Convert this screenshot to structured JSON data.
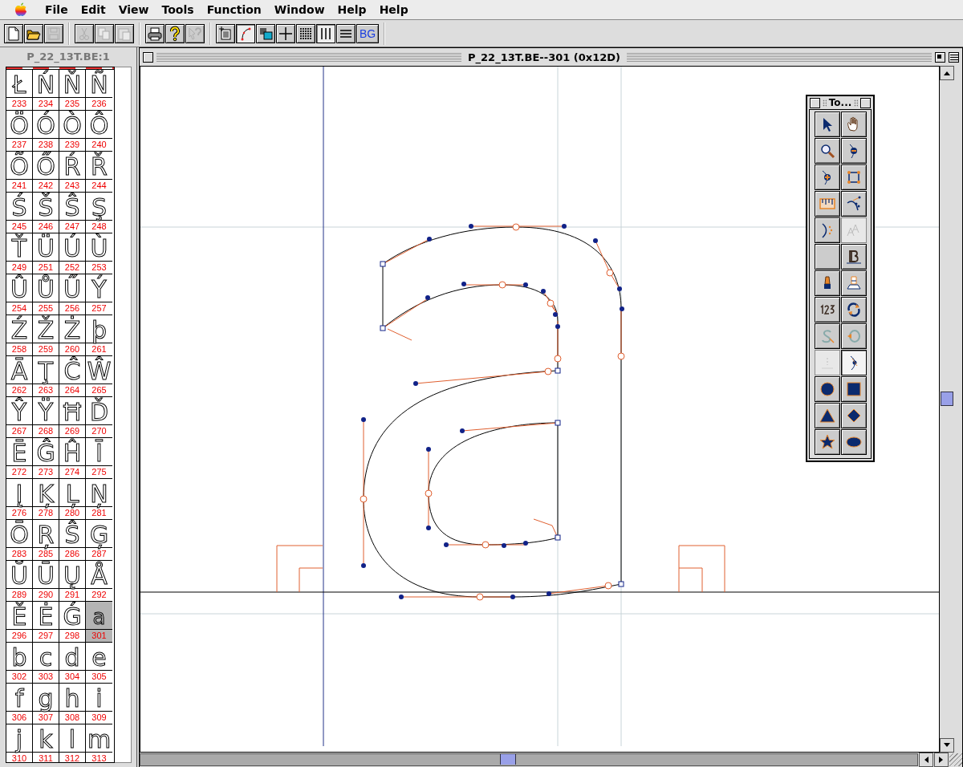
{
  "menu_bar": {
    "items": [
      "File",
      "Edit",
      "View",
      "Tools",
      "Function",
      "Window",
      "Help",
      "Help"
    ]
  },
  "toolbar": {
    "groups": [
      [
        {
          "kind": "new",
          "disabled": false
        },
        {
          "kind": "open",
          "disabled": false
        },
        {
          "kind": "save",
          "disabled": true
        }
      ],
      [
        {
          "kind": "cut",
          "disabled": true
        },
        {
          "kind": "copy",
          "disabled": true
        },
        {
          "kind": "paste",
          "disabled": true
        }
      ],
      [
        {
          "kind": "print",
          "disabled": false
        },
        {
          "kind": "help",
          "disabled": false
        },
        {
          "kind": "context-help",
          "disabled": true
        }
      ],
      [
        {
          "kind": "info",
          "disabled": false,
          "selected": false
        },
        {
          "kind": "points",
          "disabled": false,
          "selected": true
        },
        {
          "kind": "layers",
          "disabled": false,
          "selected": false
        },
        {
          "kind": "cross",
          "disabled": false,
          "selected": false
        },
        {
          "kind": "grid",
          "disabled": false,
          "selected": false
        },
        {
          "kind": "vlines",
          "disabled": false,
          "selected": true
        },
        {
          "kind": "hlines",
          "disabled": false,
          "selected": false
        },
        {
          "kind": "text",
          "label": "BG",
          "disabled": false,
          "selected": false
        }
      ]
    ]
  },
  "font_window": {
    "title": "P_22_13T.BE:1",
    "glyphs": [
      {
        "char": "Ł",
        "code": "233",
        "selected": false
      },
      {
        "char": "Ń",
        "code": "234",
        "selected": false
      },
      {
        "char": "Ň",
        "code": "235",
        "selected": false
      },
      {
        "char": "Ñ",
        "code": "236",
        "selected": false
      },
      {
        "char": "Ö",
        "code": "237",
        "selected": false
      },
      {
        "char": "Ó",
        "code": "238",
        "selected": false
      },
      {
        "char": "Ò",
        "code": "239",
        "selected": false
      },
      {
        "char": "Ô",
        "code": "240",
        "selected": false
      },
      {
        "char": "Õ",
        "code": "241",
        "selected": false
      },
      {
        "char": "Ő",
        "code": "242",
        "selected": false
      },
      {
        "char": "Ŕ",
        "code": "243",
        "selected": false
      },
      {
        "char": "Ř",
        "code": "244",
        "selected": false
      },
      {
        "char": "Ś",
        "code": "245",
        "selected": false
      },
      {
        "char": "Š",
        "code": "246",
        "selected": false
      },
      {
        "char": "Ŝ",
        "code": "247",
        "selected": false
      },
      {
        "char": "Ş",
        "code": "248",
        "selected": false
      },
      {
        "char": "Ť",
        "code": "249",
        "selected": false
      },
      {
        "char": "Ü",
        "code": "251",
        "selected": false
      },
      {
        "char": "Ú",
        "code": "252",
        "selected": false
      },
      {
        "char": "Ù",
        "code": "253",
        "selected": false
      },
      {
        "char": "Û",
        "code": "254",
        "selected": false
      },
      {
        "char": "Ů",
        "code": "255",
        "selected": false
      },
      {
        "char": "Ű",
        "code": "256",
        "selected": false
      },
      {
        "char": "Ý",
        "code": "257",
        "selected": false
      },
      {
        "char": "Ź",
        "code": "258",
        "selected": false
      },
      {
        "char": "Ž",
        "code": "259",
        "selected": false
      },
      {
        "char": "Ż",
        "code": "260",
        "selected": false
      },
      {
        "char": "þ",
        "code": "261",
        "selected": false
      },
      {
        "char": "Ā",
        "code": "262",
        "selected": false
      },
      {
        "char": "Ţ",
        "code": "263",
        "selected": false
      },
      {
        "char": "Ĉ",
        "code": "264",
        "selected": false
      },
      {
        "char": "Ŵ",
        "code": "265",
        "selected": false
      },
      {
        "char": "Ŷ",
        "code": "267",
        "selected": false
      },
      {
        "char": "Ÿ",
        "code": "268",
        "selected": false
      },
      {
        "char": "Ħ",
        "code": "269",
        "selected": false
      },
      {
        "char": "Ď",
        "code": "270",
        "selected": false
      },
      {
        "char": "Ē",
        "code": "272",
        "selected": false
      },
      {
        "char": "Ĝ",
        "code": "273",
        "selected": false
      },
      {
        "char": "Ĥ",
        "code": "274",
        "selected": false
      },
      {
        "char": "Ī",
        "code": "275",
        "selected": false
      },
      {
        "char": "Į",
        "code": "276",
        "selected": false
      },
      {
        "char": "Ķ",
        "code": "278",
        "selected": false
      },
      {
        "char": "Ļ",
        "code": "280",
        "selected": false
      },
      {
        "char": "Ņ",
        "code": "281",
        "selected": false
      },
      {
        "char": "Ō",
        "code": "283",
        "selected": false
      },
      {
        "char": "Ŗ",
        "code": "285",
        "selected": false
      },
      {
        "char": "Ŝ",
        "code": "286",
        "selected": false
      },
      {
        "char": "Ģ",
        "code": "287",
        "selected": false
      },
      {
        "char": "Ŭ",
        "code": "289",
        "selected": false
      },
      {
        "char": "Ū",
        "code": "290",
        "selected": false
      },
      {
        "char": "Ų",
        "code": "291",
        "selected": false
      },
      {
        "char": "Å",
        "code": "292",
        "selected": false
      },
      {
        "char": "Ě",
        "code": "296",
        "selected": false
      },
      {
        "char": "Ė",
        "code": "297",
        "selected": false
      },
      {
        "char": "Ǵ",
        "code": "298",
        "selected": false
      },
      {
        "char": "a",
        "code": "301",
        "selected": true
      },
      {
        "char": "b",
        "code": "302",
        "selected": false
      },
      {
        "char": "c",
        "code": "303",
        "selected": false
      },
      {
        "char": "d",
        "code": "304",
        "selected": false
      },
      {
        "char": "e",
        "code": "305",
        "selected": false
      },
      {
        "char": "f",
        "code": "306",
        "selected": false
      },
      {
        "char": "g",
        "code": "307",
        "selected": false
      },
      {
        "char": "h",
        "code": "308",
        "selected": false
      },
      {
        "char": "i",
        "code": "309",
        "selected": false
      },
      {
        "char": "j",
        "code": "310",
        "selected": false
      },
      {
        "char": "k",
        "code": "311",
        "selected": false
      },
      {
        "char": "l",
        "code": "312",
        "selected": false
      },
      {
        "char": "m",
        "code": "313",
        "selected": false
      }
    ]
  },
  "outline_window": {
    "title": "P_22_13T.BE--301 (0x12D)"
  },
  "tool_palette": {
    "title": "To...",
    "tools": [
      {
        "kind": "pointer",
        "selected": false,
        "disabled": false
      },
      {
        "kind": "hand",
        "selected": false,
        "disabled": false
      },
      {
        "kind": "zoom",
        "selected": false,
        "disabled": false
      },
      {
        "kind": "remove-point",
        "selected": false,
        "disabled": false
      },
      {
        "kind": "add-point",
        "selected": false,
        "disabled": false
      },
      {
        "kind": "rectangle-select",
        "selected": false,
        "disabled": false
      },
      {
        "kind": "ruler",
        "selected": false,
        "disabled": false
      },
      {
        "kind": "curve",
        "selected": false,
        "disabled": false
      },
      {
        "kind": "arc",
        "selected": false,
        "disabled": false
      },
      {
        "kind": "letters",
        "selected": false,
        "disabled": true
      },
      {
        "kind": "blank",
        "selected": false,
        "disabled": false
      },
      {
        "kind": "bold",
        "selected": false,
        "disabled": false
      },
      {
        "kind": "pen",
        "selected": false,
        "disabled": false
      },
      {
        "kind": "stamp",
        "selected": false,
        "disabled": false
      },
      {
        "kind": "numbers",
        "selected": false,
        "disabled": false
      },
      {
        "kind": "rotate",
        "selected": false,
        "disabled": false
      },
      {
        "kind": "skew",
        "selected": false,
        "disabled": false
      },
      {
        "kind": "reflect",
        "selected": false,
        "disabled": false
      },
      {
        "kind": "knife",
        "selected": false,
        "disabled": true
      },
      {
        "kind": "curve-point",
        "selected": true,
        "disabled": false
      },
      {
        "kind": "circle",
        "selected": false,
        "disabled": false
      },
      {
        "kind": "square",
        "selected": false,
        "disabled": false
      },
      {
        "kind": "triangle",
        "selected": false,
        "disabled": false
      },
      {
        "kind": "diamond",
        "selected": false,
        "disabled": false
      },
      {
        "kind": "star",
        "selected": false,
        "disabled": false
      },
      {
        "kind": "ellipse",
        "selected": false,
        "disabled": false
      }
    ]
  }
}
